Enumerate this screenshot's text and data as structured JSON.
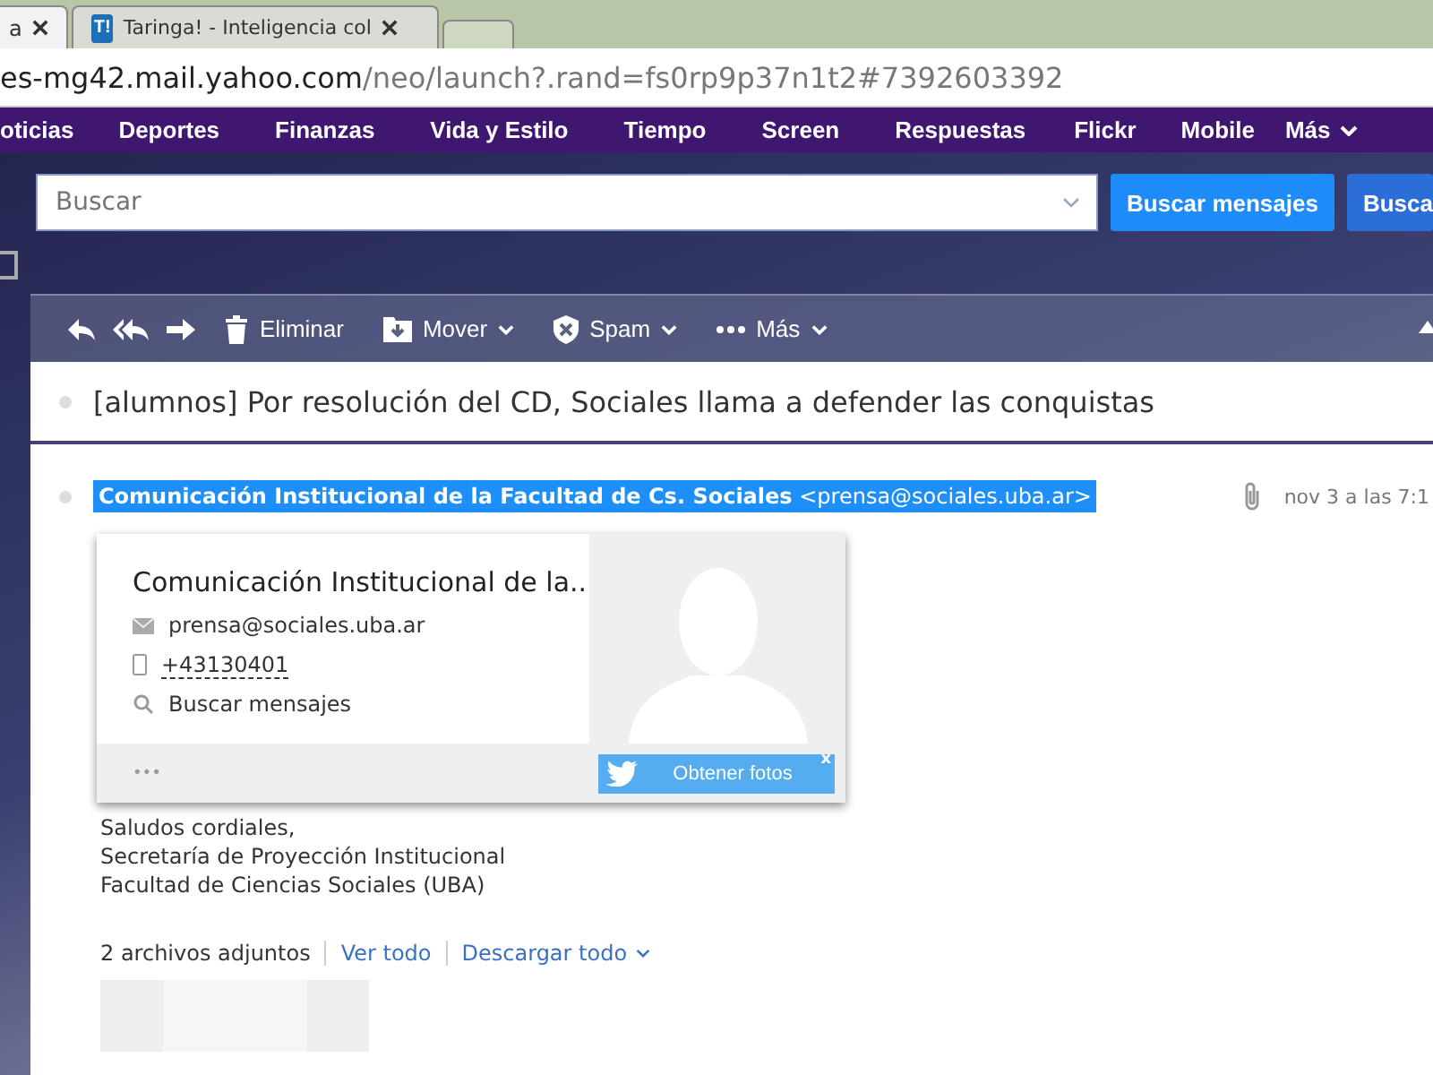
{
  "browser": {
    "tabs": [
      {
        "title": "a",
        "selected": true
      },
      {
        "title": "Taringa! - Inteligencia col",
        "favicon": "T!",
        "selected": false
      }
    ],
    "address": {
      "host": "es-mg42.mail.yahoo.com",
      "path": "/neo/launch?.rand=fs0rp9p37n1t2#7392603392"
    }
  },
  "nav": [
    {
      "label": "oticias"
    },
    {
      "label": "Deportes"
    },
    {
      "label": "Finanzas"
    },
    {
      "label": "Vida y Estilo"
    },
    {
      "label": "Tiempo"
    },
    {
      "label": "Screen"
    },
    {
      "label": "Respuestas"
    },
    {
      "label": "Flickr"
    },
    {
      "label": "Mobile"
    },
    {
      "label": "Más",
      "dropdown": true
    }
  ],
  "search": {
    "placeholder": "Buscar",
    "buttons": [
      "Buscar mensajes",
      "Busca"
    ]
  },
  "toolbar": [
    {
      "kind": "reply"
    },
    {
      "kind": "reply-all"
    },
    {
      "kind": "forward"
    },
    {
      "kind": "delete",
      "label": "Eliminar"
    },
    {
      "kind": "move",
      "label": "Mover"
    },
    {
      "kind": "spam",
      "label": "Spam"
    },
    {
      "kind": "more",
      "label": "Más"
    }
  ],
  "subject": "[alumnos] Por resolución del CD, Sociales llama a defender las conquistas",
  "message": {
    "sender_name": "Comunicación Institucional de la Facultad de Cs. Sociales",
    "sender_email": "<prensa@sociales.uba.ar>",
    "date": "nov 3 a las 7:1",
    "has_attachment": true,
    "body": [
      "Saludos cordiales,",
      "Secretaría de Proyección Institucional",
      "Facultad de Ciencias Sociales (UBA)"
    ],
    "attachments": {
      "count": "2 archivos adjuntos",
      "view_all": "Ver todo",
      "download_all": "Descargar todo"
    }
  },
  "contact_card": {
    "name": "Comunicación Institucional de la..",
    "email": "prensa@sociales.uba.ar",
    "phone": "+43130401",
    "search": "Buscar mensajes",
    "more": "•••",
    "photo_button": "Obtener fotos",
    "close": "x"
  }
}
